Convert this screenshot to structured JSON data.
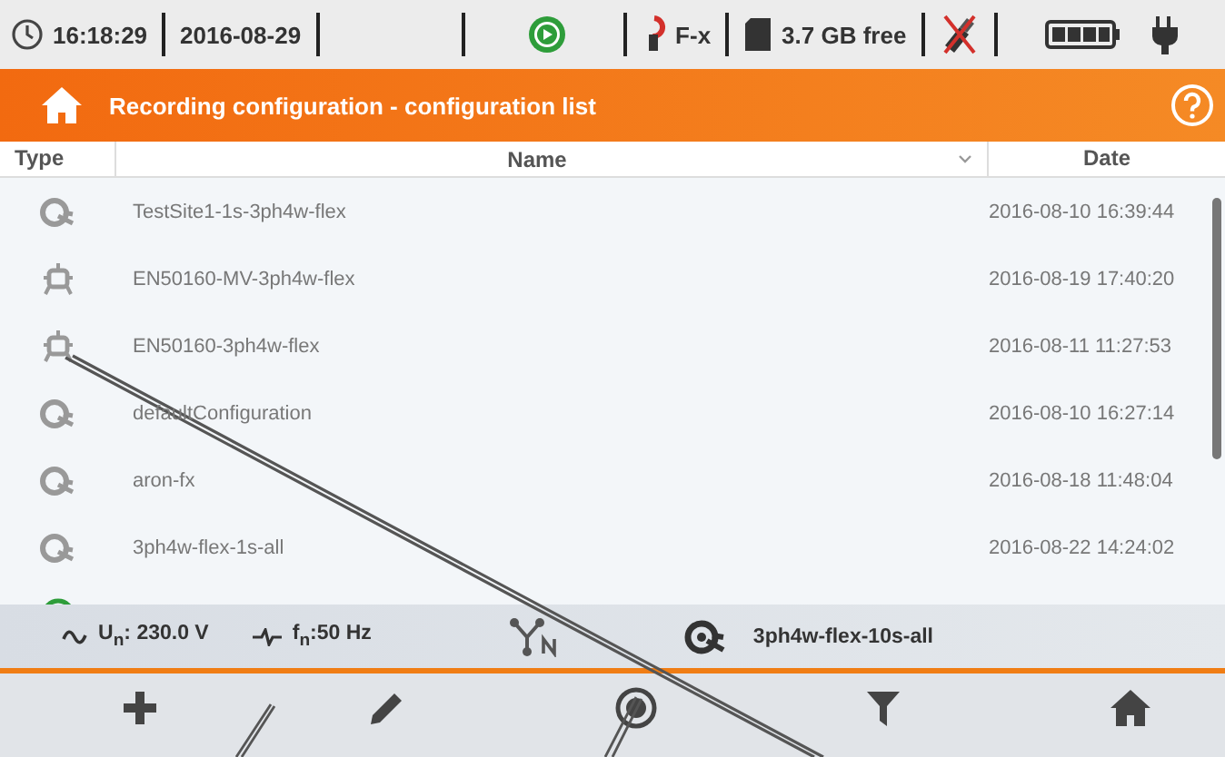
{
  "status_bar": {
    "time": "16:18:29",
    "date": "2016-08-29",
    "clamp": "F-x",
    "storage": "3.7 GB free"
  },
  "title_bar": {
    "title": "Recording configuration - configuration list"
  },
  "table": {
    "columns": [
      "Type",
      "Name",
      "Date"
    ],
    "rows": [
      {
        "kind": "config",
        "name": "TestSite1-1s-3ph4w-flex",
        "date": "2016-08-10 16:39:44"
      },
      {
        "kind": "standard",
        "name": "EN50160-MV-3ph4w-flex",
        "date": "2016-08-19 17:40:20"
      },
      {
        "kind": "standard",
        "name": "EN50160-3ph4w-flex",
        "date": "2016-08-11 11:27:53"
      },
      {
        "kind": "config",
        "name": "defaultConfiguration",
        "date": "2016-08-10 16:27:14"
      },
      {
        "kind": "config",
        "name": "aron-fx",
        "date": "2016-08-18 11:48:04"
      },
      {
        "kind": "config",
        "name": "3ph4w-flex-1s-all",
        "date": "2016-08-22 14:24:02"
      },
      {
        "kind": "active"
      }
    ]
  },
  "info_bar": {
    "voltage": "U$_{n}$: 230.0 V",
    "frequency": "f$_{n}$:50 Hz",
    "active_config": "3ph4w-flex-10s-all"
  }
}
